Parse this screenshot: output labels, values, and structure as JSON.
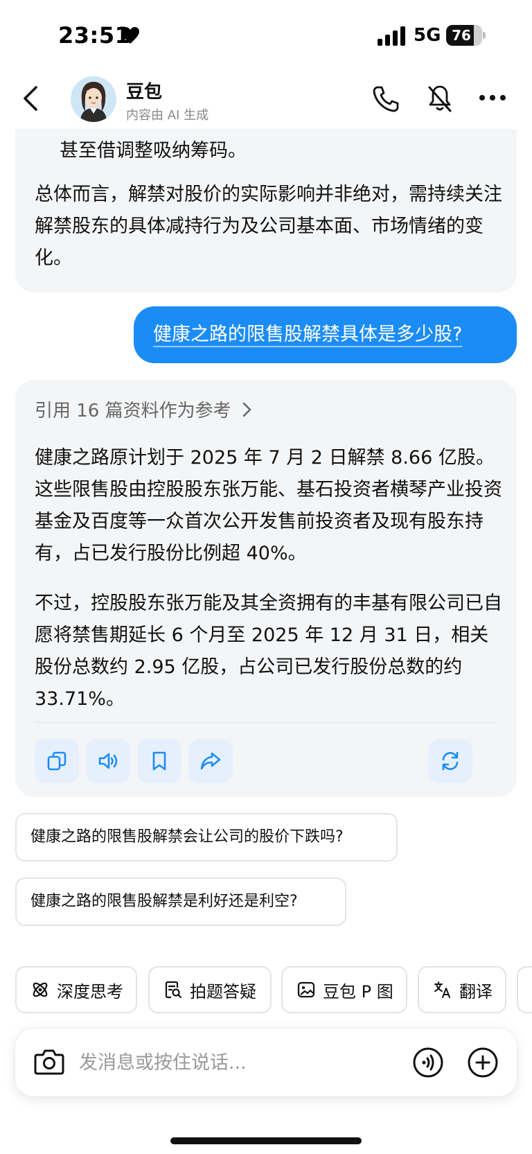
{
  "status_bar": {
    "time": "23:51",
    "network": "5G",
    "battery": "76",
    "battery_level": 0.76
  },
  "header": {
    "name": "豆包",
    "subtitle": "内容由 AI 生成"
  },
  "messages": {
    "ai_previous": {
      "tail_line": "甚至借调整吸纳筹码。",
      "paragraph": "总体而言，解禁对股价的实际影响并非绝对，需持续关注解禁股东的具体减持行为及公司基本面、市场情绪的变化。"
    },
    "user": {
      "text": "健康之路的限售股解禁具体是多少股?"
    },
    "ai_current": {
      "reference": "引用 16 篇资料作为参考",
      "paragraph1": "健康之路原计划于 2025 年 7 月 2 日解禁 8.66 亿股。这些限售股由控股股东张万能、基石投资者横琴产业投资基金及百度等一众首次公开发售前投资者及现有股东持有，占已发行股份比例超 40%。",
      "paragraph2": "不过，控股股东张万能及其全资拥有的丰基有限公司已自愿将禁售期延长 6 个月至 2025 年 12 月 31 日，相关股份总数约 2.95 亿股，占公司已发行股份总数的约 33.71%。"
    }
  },
  "suggestions": [
    "健康之路的限售股解禁会让公司的股价下跌吗?",
    "健康之路的限售股解禁是利好还是利空?"
  ],
  "tools": [
    "深度思考",
    "拍题答疑",
    "豆包 P 图",
    "翻译"
  ],
  "input": {
    "placeholder": "发消息或按住说话..."
  },
  "colors": {
    "accent": "#1c8cf5",
    "bubble_bg": "#f4f5f7",
    "action_btn_bg": "#e6f0fd"
  },
  "icons": [
    "heart-icon",
    "signal-icon",
    "back-icon",
    "phone-icon",
    "mute-icon",
    "more-icon",
    "chevron-right-icon",
    "copy-icon",
    "speaker-icon",
    "bookmark-icon",
    "share-icon",
    "refresh-icon",
    "atom-icon",
    "search-doc-icon",
    "image-edit-icon",
    "translate-icon",
    "camera-icon",
    "voice-icon",
    "plus-icon"
  ]
}
